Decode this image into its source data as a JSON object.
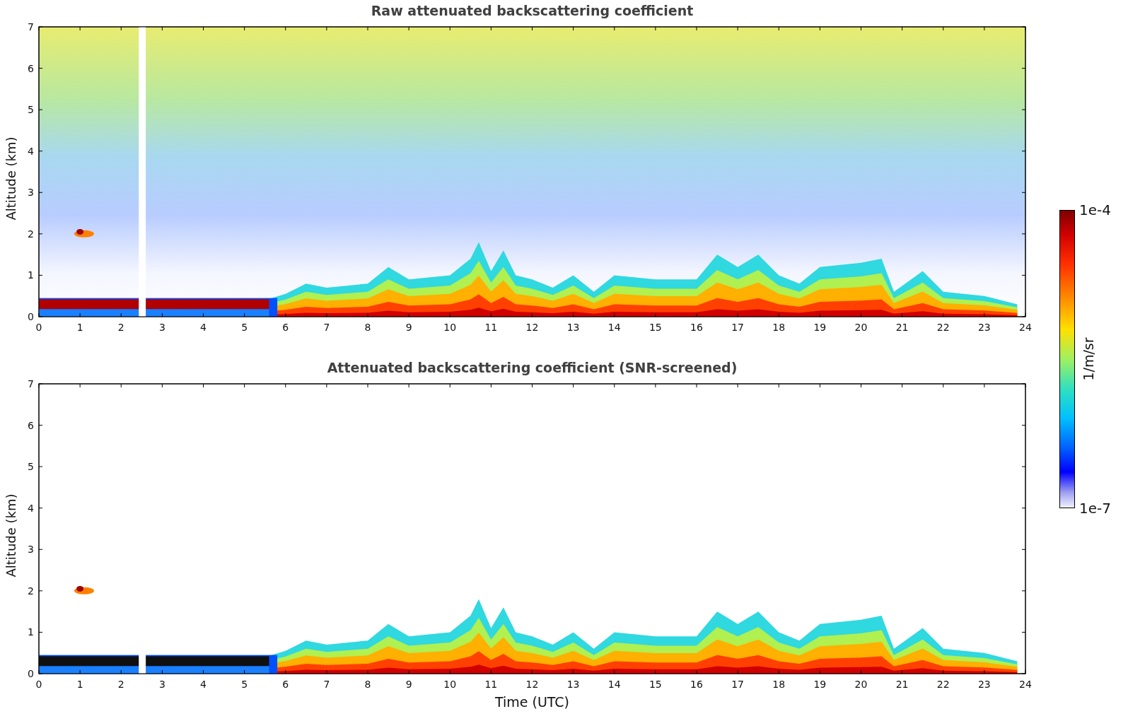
{
  "panels": [
    {
      "kind": "raw",
      "title": "Raw attenuated backscattering coefficient",
      "ylabel": "Altitude (km)",
      "yticks": [
        "7",
        "6",
        "5",
        "4",
        "3",
        "2",
        "1",
        "0"
      ],
      "xticks": [
        "0",
        "1",
        "2",
        "3",
        "4",
        "5",
        "6",
        "7",
        "8",
        "9",
        "10",
        "11",
        "12",
        "13",
        "14",
        "15",
        "16",
        "17",
        "18",
        "19",
        "20",
        "21",
        "22",
        "23",
        "24"
      ]
    },
    {
      "kind": "screened",
      "title": "Attenuated backscattering coefficient (SNR-screened)",
      "ylabel": "Altitude (km)",
      "yticks": [
        "7",
        "6",
        "5",
        "4",
        "3",
        "2",
        "1",
        "0"
      ],
      "xticks": [
        "0",
        "1",
        "2",
        "3",
        "4",
        "5",
        "6",
        "7",
        "8",
        "9",
        "10",
        "11",
        "12",
        "13",
        "14",
        "15",
        "16",
        "17",
        "18",
        "19",
        "20",
        "21",
        "22",
        "23",
        "24"
      ],
      "xlabel": "Time (UTC)"
    }
  ],
  "colorbar": {
    "max_label": "1e-4",
    "label": "1/m/sr",
    "min_label": "1e-7"
  }
}
